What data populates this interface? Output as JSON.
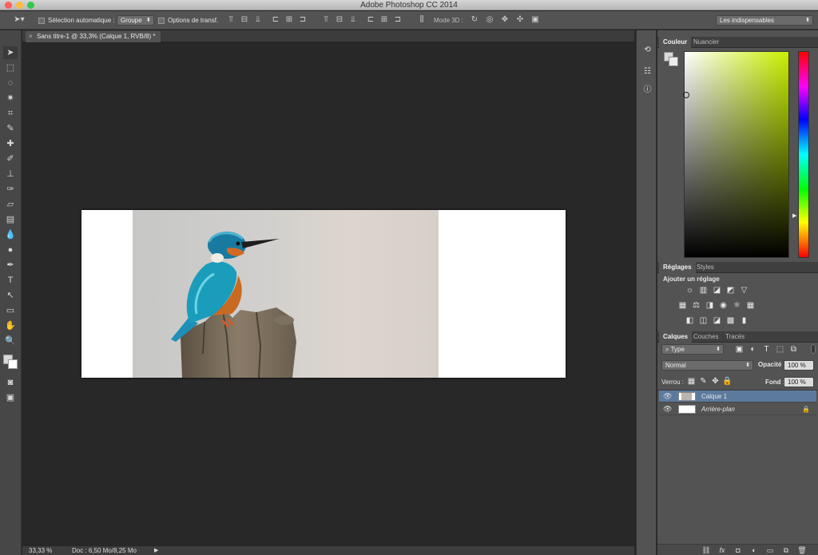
{
  "window": {
    "title": "Adobe Photoshop CC 2014",
    "traffic_lights": [
      "#fc605c",
      "#fdbc40",
      "#34c84a"
    ]
  },
  "options_bar": {
    "auto_select_label": "Sélection automatique :",
    "auto_select_value": "Groupe",
    "transform_label": "Options de transf.",
    "mode3d_label": "Mode 3D :",
    "workspace_value": "Les indispensables"
  },
  "document": {
    "tab_title": "Sans titre-1 @ 33,3% (Calque 1, RVB/8) *",
    "close_glyph": "×"
  },
  "status": {
    "zoom": "33,33 %",
    "doc_info": "Doc : 6,50 Mo/8,25 Mo"
  },
  "color_panel": {
    "tabs": [
      "Couleur",
      "Nuancier"
    ],
    "hue_color": "#c8f000"
  },
  "adjust_panel": {
    "tabs": [
      "Réglages",
      "Styles"
    ],
    "heading": "Ajouter un réglage"
  },
  "layers_panel": {
    "tabs": [
      "Calques",
      "Couches",
      "Tracés"
    ],
    "filter_value": "Type",
    "blend_mode": "Normal",
    "opacity_label": "Opacité :",
    "opacity_value": "100 %",
    "lock_label": "Verrou :",
    "fill_label": "Fond :",
    "fill_value": "100 %",
    "layers": [
      {
        "name": "Calque 1",
        "selected": true
      },
      {
        "name": "Arrière-plan",
        "selected": false
      }
    ]
  },
  "colors": {
    "selection_blue": "#5c7a9e",
    "app_dark": "#282828",
    "panel_gray": "#535353"
  }
}
